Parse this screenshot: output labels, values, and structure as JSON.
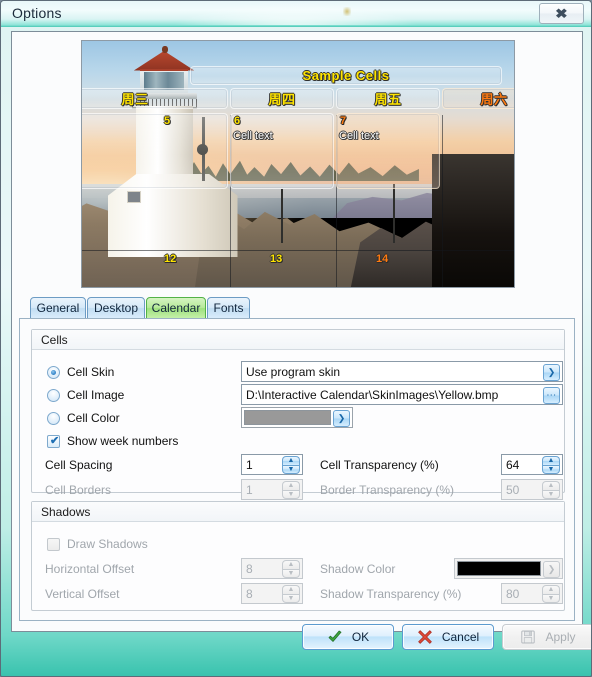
{
  "window": {
    "title": "Options",
    "close_label": "✖",
    "close_icon": "close-icon"
  },
  "preview": {
    "title_cell": "Sample Cells",
    "weekday_headers": [
      {
        "label": "周三",
        "color": "#ffe400",
        "weekend": false
      },
      {
        "label": "周四",
        "color": "#ffe400",
        "weekend": false
      },
      {
        "label": "周五",
        "color": "#ffe400",
        "weekend": false
      },
      {
        "label": "周六",
        "color": "#ff7a10",
        "weekend": true
      }
    ],
    "row1": [
      {
        "day": "5",
        "text": "",
        "weekend": false
      },
      {
        "day": "6",
        "text": "Cell text",
        "weekend": false
      },
      {
        "day": "7",
        "text": "Cell text",
        "weekend": true
      }
    ],
    "row2": [
      {
        "day": "12",
        "weekend": false
      },
      {
        "day": "13",
        "weekend": false
      },
      {
        "day": "14",
        "weekend": true
      }
    ]
  },
  "tabs": [
    {
      "label": "General",
      "active": false
    },
    {
      "label": "Desktop",
      "active": false
    },
    {
      "label": "Calendar",
      "active": true
    },
    {
      "label": "Fonts",
      "active": false
    }
  ],
  "cells_group": {
    "title": "Cells",
    "cell_skin_label": "Cell Skin",
    "cell_skin_value": "Use program skin",
    "cell_image_label": "Cell Image",
    "cell_image_value": "D:\\Interactive Calendar\\SkinImages\\Yellow.bmp",
    "browse_label": "⋯",
    "cell_color_label": "Cell Color",
    "cell_color_value": "#999999",
    "show_week_numbers_label": "Show week numbers",
    "show_week_numbers_checked": true,
    "check_glyph": "✔",
    "cell_spacing_label": "Cell Spacing",
    "cell_spacing_value": "1",
    "cell_transparency_label": "Cell Transparency (%)",
    "cell_transparency_value": "64",
    "cell_borders_label": "Cell Borders",
    "cell_borders_value": "1",
    "border_transparency_label": "Border Transparency (%)",
    "border_transparency_value": "50",
    "selected_option": "Cell Skin"
  },
  "shadows_group": {
    "title": "Shadows",
    "draw_shadows_label": "Draw Shadows",
    "draw_shadows_checked": false,
    "horizontal_offset_label": "Horizontal Offset",
    "horizontal_offset_value": "8",
    "vertical_offset_label": "Vertical Offset",
    "vertical_offset_value": "8",
    "shadow_color_label": "Shadow Color",
    "shadow_color_value": "#000000",
    "shadow_transparency_label": "Shadow Transparency (%)",
    "shadow_transparency_value": "80"
  },
  "buttons": {
    "ok": "OK",
    "cancel": "Cancel",
    "apply": "Apply",
    "apply_enabled": false
  },
  "glyphs": {
    "arrow_down": "❯",
    "spin_up": "▲",
    "spin_down": "▼"
  }
}
